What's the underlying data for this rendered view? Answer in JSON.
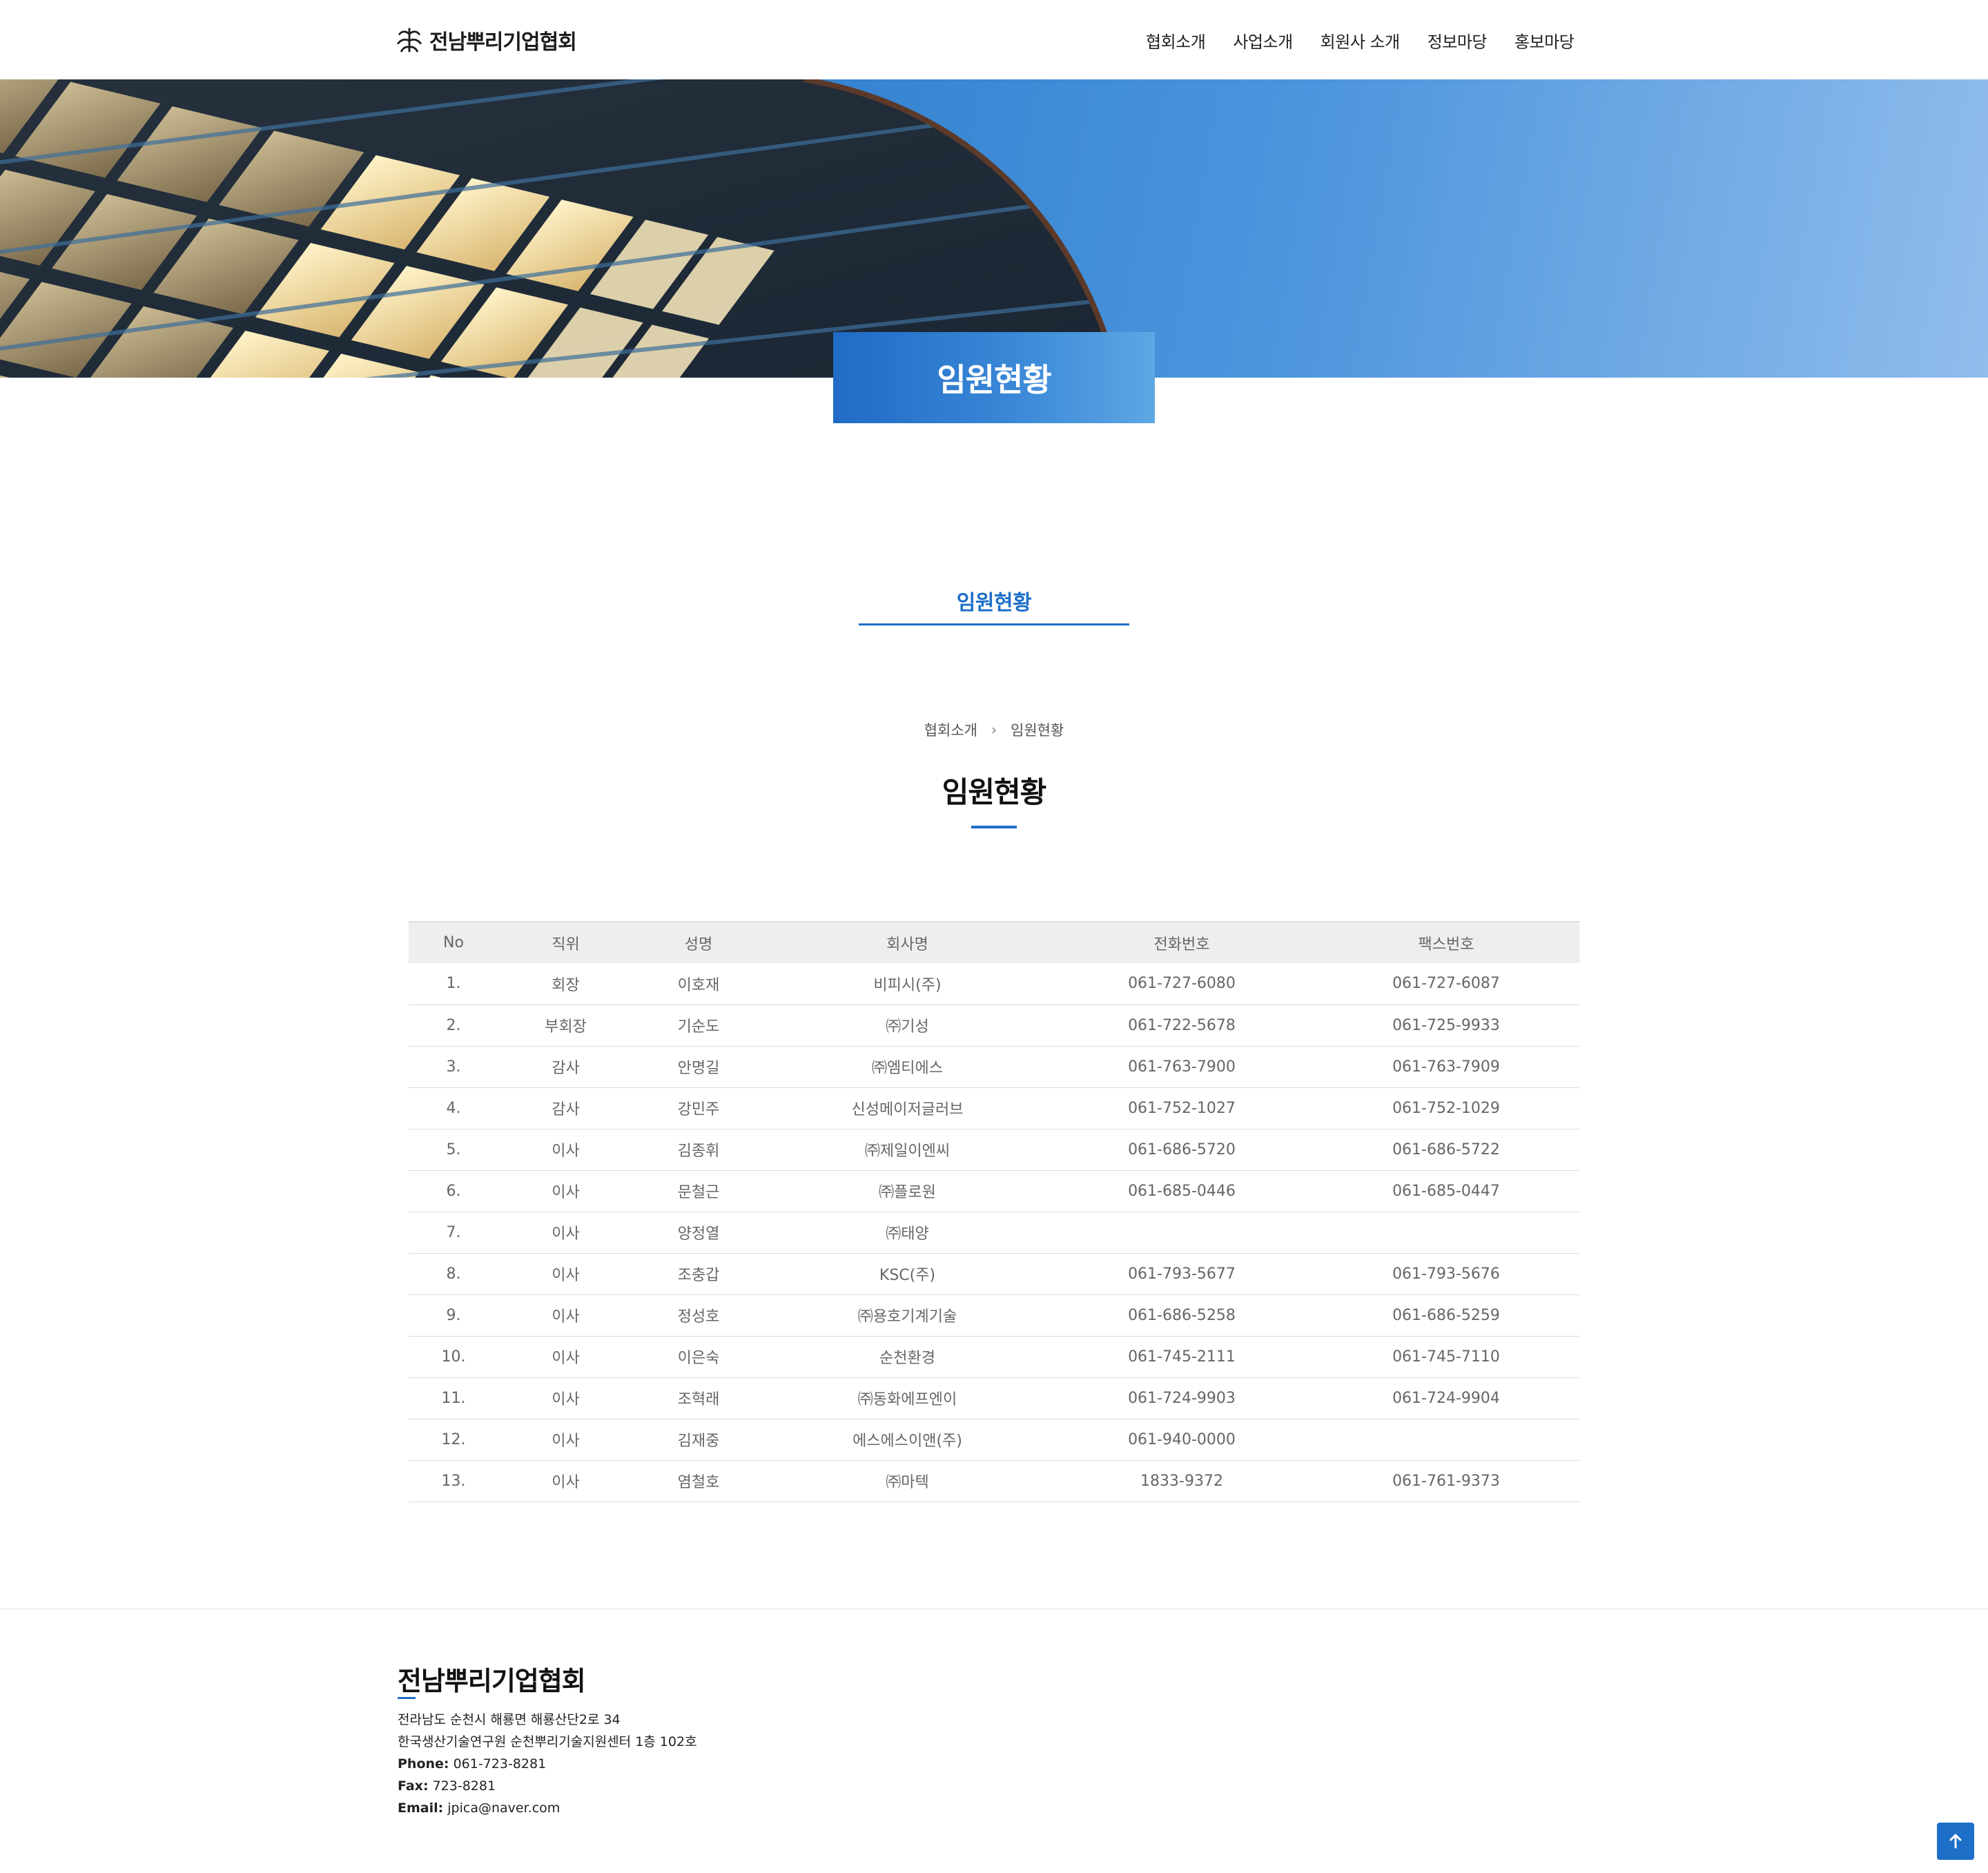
{
  "header": {
    "logo_text": "전남뿌리기업협회",
    "nav": [
      "협회소개",
      "사업소개",
      "회원사 소개",
      "정보마당",
      "홍보마당"
    ]
  },
  "hero": {
    "title": "임원현황"
  },
  "subtab": {
    "label": "임원현황"
  },
  "breadcrumb": {
    "parent": "협회소개",
    "separator": "›",
    "current": "임원현황"
  },
  "page_title": "임원현황",
  "table": {
    "headers": [
      "No",
      "직위",
      "성명",
      "회사명",
      "전화번호",
      "팩스번호"
    ],
    "rows": [
      [
        "1.",
        "회장",
        "이호재",
        "비피시(주)",
        "061-727-6080",
        "061-727-6087"
      ],
      [
        "2.",
        "부회장",
        "기순도",
        "㈜기성",
        "061-722-5678",
        "061-725-9933"
      ],
      [
        "3.",
        "감사",
        "안명길",
        "㈜엠티에스",
        "061-763-7900",
        "061-763-7909"
      ],
      [
        "4.",
        "감사",
        "강민주",
        "신성메이저글러브",
        "061-752-1027",
        "061-752-1029"
      ],
      [
        "5.",
        "이사",
        "김종휘",
        "㈜제일이엔씨",
        "061-686-5720",
        "061-686-5722"
      ],
      [
        "6.",
        "이사",
        "문철근",
        "㈜플로원",
        "061-685-0446",
        "061-685-0447"
      ],
      [
        "7.",
        "이사",
        "양정열",
        "㈜태양",
        "",
        ""
      ],
      [
        "8.",
        "이사",
        "조충갑",
        "KSC(주)",
        "061-793-5677",
        "061-793-5676"
      ],
      [
        "9.",
        "이사",
        "정성호",
        "㈜용호기계기술",
        "061-686-5258",
        "061-686-5259"
      ],
      [
        "10.",
        "이사",
        "이은숙",
        "순천환경",
        "061-745-2111",
        "061-745-7110"
      ],
      [
        "11.",
        "이사",
        "조혁래",
        "㈜동화에프엔이",
        "061-724-9903",
        "061-724-9904"
      ],
      [
        "12.",
        "이사",
        "김재중",
        "에스에스이앤(주)",
        "061-940-0000",
        ""
      ],
      [
        "13.",
        "이사",
        "염철호",
        "㈜마텍",
        "1833-9372",
        "061-761-9373"
      ]
    ]
  },
  "footer": {
    "title": "전남뿌리기업협회",
    "address1": "전라남도 순천시 해룡면 해룡산단2로 34",
    "address2": "한국생산기술연구원 순천뿌리기술지원센터 1층 102호",
    "phone_label": "Phone:",
    "phone": "061-723-8281",
    "fax_label": "Fax:",
    "fax": "723-8281",
    "email_label": "Email:",
    "email": "jpica@naver.com"
  },
  "icons": {
    "logo": "logo-emblem-icon",
    "top_button": "arrow-up-icon"
  },
  "colors": {
    "accent": "#1e6fc8",
    "table_header_bg": "#eeeeee",
    "text_muted": "#666666"
  }
}
